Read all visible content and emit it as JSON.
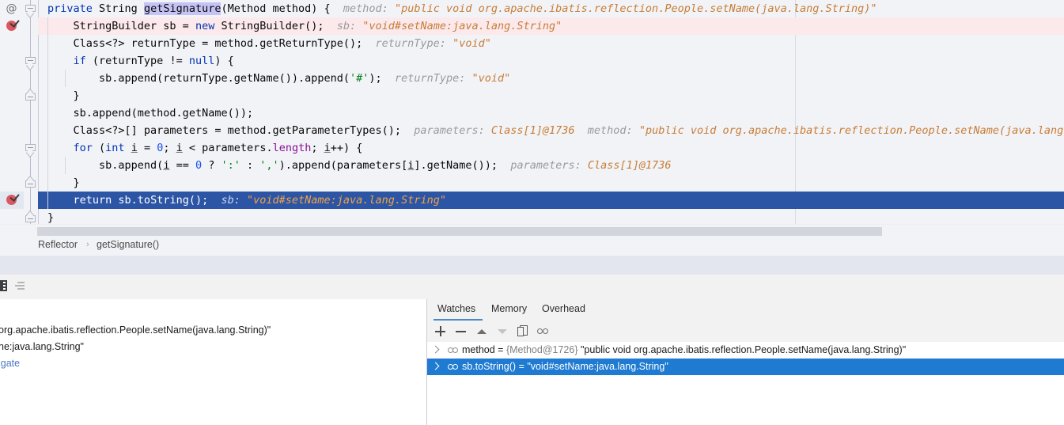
{
  "editor": {
    "right_margin_col_x": 1005,
    "lines": [
      {
        "id": "line1",
        "indent": 0,
        "code_html": "<span class=\"kw\">private</span> String <span class=\"caret-hl\">getSignature</span>(Method method) {",
        "hint_label": "method:",
        "hint_value": "\"public void org.apache.ibatis.reflection.People.setName(java.lang.String)\"",
        "state": "normal",
        "gutter": "at-icon"
      },
      {
        "id": "line2",
        "indent": 1,
        "code_html": "StringBuilder sb = <span class=\"kw\">new</span> StringBuilder();",
        "hint_label": "sb:",
        "hint_value": "\"void#setName:java.lang.String\"",
        "state": "breakpoint",
        "gutter": "breakpoint-verified"
      },
      {
        "id": "line3",
        "indent": 1,
        "code_html": "Class&lt;?&gt; returnType = method.getReturnType();",
        "hint_label": "returnType:",
        "hint_value": "\"void\"",
        "state": "normal",
        "gutter": ""
      },
      {
        "id": "line4",
        "indent": 1,
        "code_html": "<span class=\"kw\">if</span> (returnType != <span class=\"kw\">null</span>) {",
        "hint_label": "",
        "hint_value": "",
        "state": "normal",
        "gutter": ""
      },
      {
        "id": "line5",
        "indent": 2,
        "code_html": "sb.append(returnType.getName()).append(<span class=\"str\">'#'</span>);",
        "hint_label": "returnType:",
        "hint_value": "\"void\"",
        "state": "normal",
        "gutter": ""
      },
      {
        "id": "line6",
        "indent": 1,
        "code_html": "}",
        "hint_label": "",
        "hint_value": "",
        "state": "normal",
        "gutter": ""
      },
      {
        "id": "line7",
        "indent": 1,
        "code_html": "sb.append(method.getName());",
        "hint_label": "",
        "hint_value": "",
        "state": "normal",
        "gutter": ""
      },
      {
        "id": "line8",
        "indent": 1,
        "code_html": "Class&lt;?&gt;[] parameters = method.getParameterTypes();",
        "hint_label": "parameters:",
        "hint_value": "Class[1]@1736",
        "hint_label2": "method:",
        "hint_value2": "\"public void org.apache.ibatis.reflection.People.setName(java.lang.",
        "state": "normal",
        "gutter": ""
      },
      {
        "id": "line9",
        "indent": 1,
        "code_html": "<span class=\"kw\">for</span> (<span class=\"kw\">int</span> <span class=\"localvar\">i</span> = <span class=\"num\">0</span>; <span class=\"localvar\">i</span> &lt; parameters.<span class=\"fld\">length</span>; <span class=\"localvar\">i</span>++) {",
        "hint_label": "",
        "hint_value": "",
        "state": "normal",
        "gutter": ""
      },
      {
        "id": "line10",
        "indent": 2,
        "code_html": "sb.append(<span class=\"localvar\">i</span> == <span class=\"num\">0</span> ? <span class=\"str\">':'</span> : <span class=\"str\">','</span>).append(parameters[<span class=\"localvar\">i</span>].getName());",
        "hint_label": "parameters:",
        "hint_value": "Class[1]@1736",
        "state": "normal",
        "gutter": ""
      },
      {
        "id": "line11",
        "indent": 1,
        "code_html": "}",
        "hint_label": "",
        "hint_value": "",
        "state": "normal",
        "gutter": ""
      },
      {
        "id": "line12",
        "indent": 1,
        "code_html": "<span class=\"kw\">return</span> sb.toString();",
        "hint_label": "sb:",
        "hint_value": "\"void#setName:java.lang.String\"",
        "state": "current",
        "gutter": "breakpoint-verified"
      },
      {
        "id": "line13",
        "indent": 0,
        "code_html": "}",
        "hint_label": "",
        "hint_value": "",
        "state": "normal",
        "gutter": ""
      }
    ]
  },
  "breadcrumb": {
    "class_name": "Reflector",
    "separator": "›",
    "method_name": "getSignature()"
  },
  "debug_strip": {
    "frames_icon": "frames-icon",
    "variables_icon": "variables-icon"
  },
  "variables_panel": {
    "lines": [
      "org.apache.ibatis.reflection.People.setName(java.lang.String)\"",
      "ne:java.lang.String\"",
      "igate"
    ]
  },
  "watches_panel": {
    "tabs": [
      {
        "label": "Watches",
        "active": true
      },
      {
        "label": "Memory",
        "active": false
      },
      {
        "label": "Overhead",
        "active": false
      }
    ],
    "toolbar": [
      {
        "name": "add-watch-button",
        "glyph": "plus"
      },
      {
        "name": "remove-watch-button",
        "glyph": "minus"
      },
      {
        "name": "move-watch-up-button",
        "glyph": "up"
      },
      {
        "name": "move-watch-down-button",
        "glyph": "down"
      },
      {
        "name": "copy-watch-button",
        "glyph": "copy"
      },
      {
        "name": "watch-glasses-button",
        "glyph": "glasses"
      }
    ],
    "rows": [
      {
        "name": "method",
        "equals": "=",
        "type": "{Method@1726}",
        "value": "\"public void org.apache.ibatis.reflection.People.setName(java.lang.String)\"",
        "selected": false
      },
      {
        "name": "sb.toString()",
        "equals": "=",
        "type": "",
        "value": "\"void#setName:java.lang.String\"",
        "selected": true
      }
    ]
  },
  "colors": {
    "editor_bg": "#f2f3f7",
    "breakpoint_line": "#fbe9ec",
    "current_line": "#2c56a5",
    "selection_blue": "#1f7bd1",
    "hint_gray": "#9a9a9a",
    "hint_value_orange": "#c77d37",
    "keyword_blue": "#0033b3",
    "tab_underline": "#4a88c7",
    "breakpoint_red": "#db5860"
  }
}
